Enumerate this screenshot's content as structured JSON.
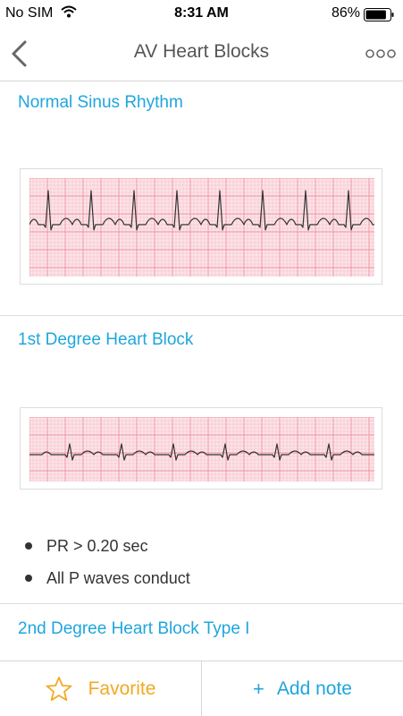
{
  "status_bar": {
    "carrier": "No SIM",
    "time": "8:31 AM",
    "battery_percent": "86%",
    "battery_level": 0.86,
    "wifi_icon": "wifi-icon"
  },
  "nav": {
    "title": "AV Heart Blocks",
    "back_icon": "chevron-left-icon",
    "more_icon": "more-icon"
  },
  "sections": [
    {
      "title": "Normal Sinus Rhythm",
      "strip": "ecg-strip-normal-sinus"
    },
    {
      "title": "1st Degree Heart Block",
      "strip": "ecg-strip-first-degree",
      "bullets": [
        "PR > 0.20 sec",
        "All P waves conduct"
      ]
    },
    {
      "title": "2nd Degree Heart Block Type I"
    }
  ],
  "toolbar": {
    "favorite_label": "Favorite",
    "add_note_plus": "+",
    "add_note_label": "Add note"
  },
  "colors": {
    "accent_blue": "#1ea6dd",
    "favorite_orange": "#f2a922",
    "ecg_grid": "#f08a99",
    "ecg_trace": "#333333"
  }
}
